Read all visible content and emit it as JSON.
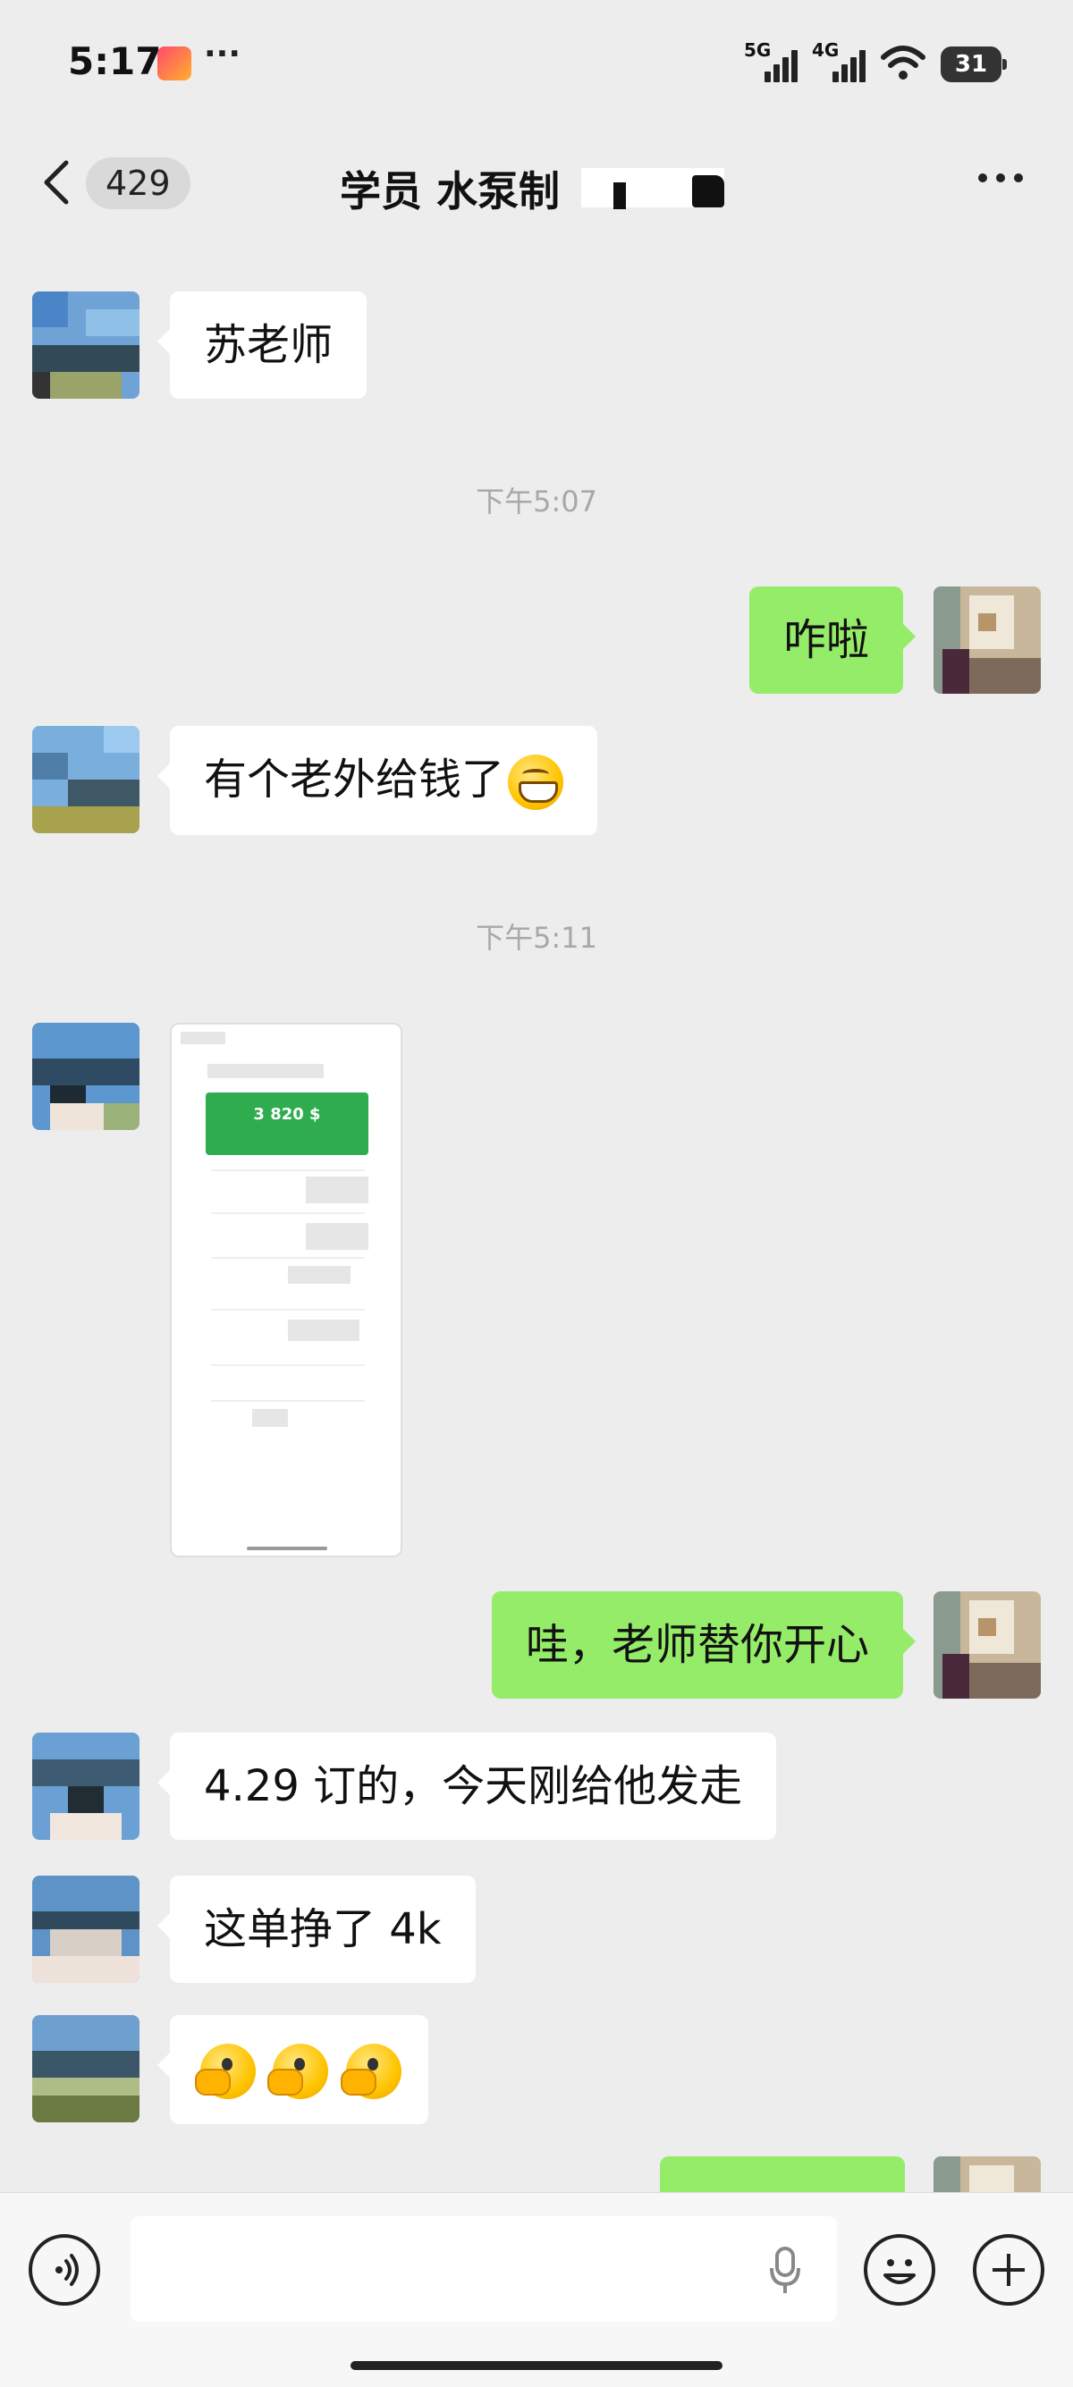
{
  "status_bar": {
    "time": "5:17",
    "more": "···",
    "signal_1": "5G",
    "signal_2": "4G",
    "battery": "31"
  },
  "nav": {
    "unread_count": "429",
    "title": "学员 水泵制"
  },
  "messages": [
    {
      "side": "them",
      "text": "苏老师"
    },
    {
      "type": "time",
      "text": "下午5:07"
    },
    {
      "side": "me",
      "text": "咋啦"
    },
    {
      "side": "them",
      "text": "有个老外给钱了"
    },
    {
      "type": "time",
      "text": "下午5:11"
    },
    {
      "side": "them",
      "type": "image",
      "amount": "3 820 $"
    },
    {
      "side": "me",
      "text": "哇，老师替你开心"
    },
    {
      "side": "them",
      "text": "4.29 订的，今天刚给他发走"
    },
    {
      "side": "them",
      "text": "这单挣了 4k"
    },
    {
      "side": "them",
      "type": "emoji-row"
    },
    {
      "side": "me",
      "type": "partial"
    }
  ],
  "colors": {
    "background": "#ededed",
    "my_bubble": "#95ec69",
    "their_bubble": "#ffffff",
    "image_header": "#2fad4e"
  },
  "icons": {
    "voice": "voice-icon",
    "mic": "mic-icon",
    "emoji": "emoji-icon",
    "plus": "plus-icon"
  }
}
